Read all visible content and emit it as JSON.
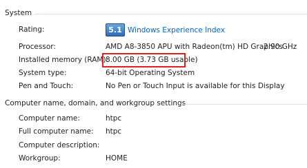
{
  "system": {
    "heading": "System",
    "rating_label": "Rating:",
    "rating_score": "5.1",
    "rating_link": "Windows Experience Index",
    "processor_label": "Processor:",
    "processor_value": "AMD A8-3850 APU with Radeon(tm) HD Graphics",
    "processor_speed": "2.90 GHz",
    "memory_label": "Installed memory (RAM):",
    "memory_value": "8.00 GB (3.73 GB usable)",
    "system_type_label": "System type:",
    "system_type_value": "64-bit Operating System",
    "pen_touch_label": "Pen and Touch:",
    "pen_touch_value": "No Pen or Touch Input is available for this Display"
  },
  "network": {
    "heading": "Computer name, domain, and workgroup settings",
    "computer_name_label": "Computer name:",
    "computer_name_value": "htpc",
    "full_name_label": "Full computer name:",
    "full_name_value": "htpc",
    "description_label": "Computer description:",
    "description_value": "",
    "workgroup_label": "Workgroup:",
    "workgroup_value": "HOME"
  },
  "colors": {
    "link": "#0066cc",
    "highlight_box": "#e02020"
  }
}
